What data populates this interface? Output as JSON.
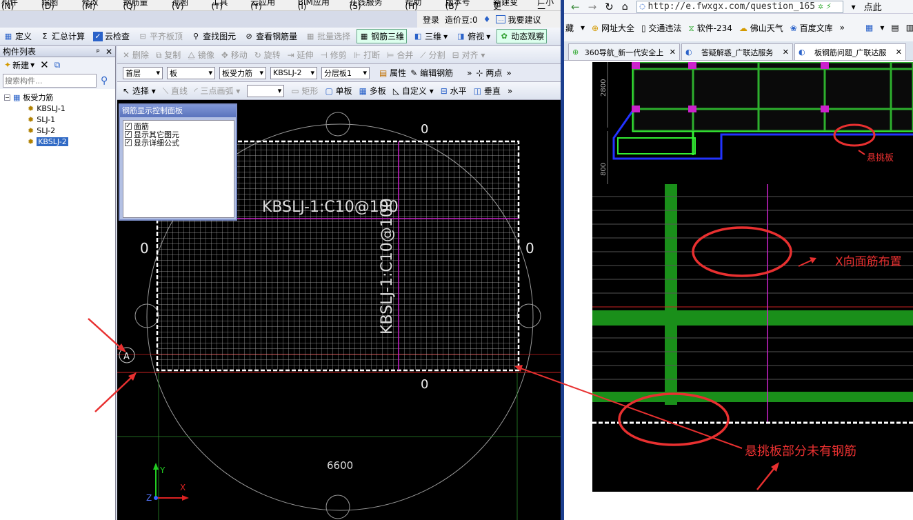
{
  "menu": [
    "构件(N)",
    "绘图(D)",
    "修改(M)",
    "钢筋量(Q)",
    "视图(V)",
    "工具(T)",
    "云应用(Y)",
    "BIM应用(I)",
    "在线服务(S)",
    "帮助(H)",
    "版本号(B)",
    "新建变更",
    "广小二"
  ],
  "login": {
    "login_label": "登录",
    "bean_label": "造价豆:0",
    "suggest_label": "我要建议"
  },
  "toolbar1": [
    "定义",
    "汇总计算",
    "云检查",
    "平齐板顶",
    "查找图元",
    "查看钢筋量",
    "批量选择",
    "钢筋三维",
    "三维",
    "俯视",
    "动态观察"
  ],
  "left_panel": {
    "title": "构件列表",
    "new_label": "新建",
    "search_placeholder": "搜索构件...",
    "tree_root": "板受力筋",
    "tree_items": [
      "KBSLJ-1",
      "SLJ-1",
      "SLJ-2",
      "KBSLJ-2"
    ]
  },
  "toolbar2": [
    "删除",
    "复制",
    "镜像",
    "移动",
    "旋转",
    "延伸",
    "修剪",
    "打断",
    "合并",
    "分割",
    "对齐"
  ],
  "filter": {
    "floor": "首层",
    "type": "板",
    "subtype": "板受力筋",
    "name": "KBSLJ-2",
    "layer": "分层板1",
    "property": "属性",
    "edit_rebar": "编辑钢筋",
    "two_point": "两点"
  },
  "toolbar3": [
    "选择",
    "直线",
    "三点画弧",
    "矩形",
    "单板",
    "多板",
    "自定义",
    "水平",
    "垂直"
  ],
  "control_panel": {
    "title": "钢筋显示控制面板",
    "options": [
      "面筋",
      "显示其它图元",
      "显示详细公式"
    ]
  },
  "drawing": {
    "label_h": "KBSLJ-1:C10@100",
    "label_v": "KBSLJ-1:C10@100",
    "zero": "0",
    "axis_a": "A",
    "dimension": "6600",
    "axis_y": "Y",
    "axis_x": "X",
    "axis_z": "Z"
  },
  "browser": {
    "url": "http://e.fwxgx.com/question_165",
    "right_text": "点此",
    "favorites": [
      "藏",
      "网址大全",
      "交通违法",
      "软件-234",
      "佛山天气",
      "百度文库"
    ],
    "tabs": [
      "360导航_新一代安全上",
      "答疑解惑_广联达服务",
      "板钢筋问题_广联达服"
    ]
  },
  "annotation": {
    "dim_2800": "2800",
    "dim_800": "800",
    "cantilever": "悬挑板",
    "x_direction": "X向面筋布置",
    "no_rebar": "悬挑板部分未有钢筋"
  },
  "colors": {
    "rebar_green": "#33ee33",
    "annotation_red": "#e83030",
    "magenta": "#cc22cc"
  }
}
